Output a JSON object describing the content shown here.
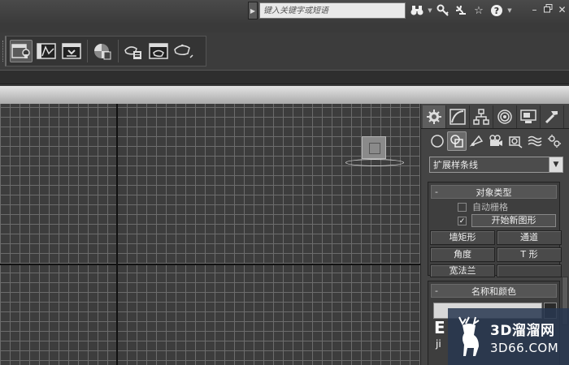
{
  "titlebar": {
    "search_placeholder": "键入关键字或短语",
    "icons": [
      "search-binoculars-icon",
      "key-icon",
      "satellite-icon",
      "star-icon",
      "help-icon"
    ],
    "window_controls": [
      "minimize-icon",
      "restore-icon",
      "close-icon"
    ]
  },
  "toolbar": {
    "icons": [
      "scene-explorer-icon",
      "curve-editor-icon",
      "schematic-view-icon",
      "material-editor-icon",
      "render-setup-icon",
      "rendered-frame-icon",
      "render-icon"
    ]
  },
  "command_panel": {
    "tabs": [
      "create-icon",
      "modify-icon",
      "hierarchy-icon",
      "motion-icon",
      "display-icon",
      "utilities-icon"
    ],
    "categories": [
      "geometry-icon",
      "shapes-icon",
      "lights-icon",
      "cameras-icon",
      "helpers-icon",
      "space-warps-icon",
      "systems-icon"
    ],
    "subcategory": "扩展样条线",
    "object_type": {
      "title": "对象类型",
      "autogrid_label": "自动栅格",
      "autogrid_checked": false,
      "start_new_shape_label": "开始新图形",
      "start_new_shape_checked": true,
      "buttons": [
        "墙矩形",
        "通道",
        "角度",
        "T 形",
        "宽法兰"
      ]
    },
    "name_color": {
      "title": "名称和颜色"
    }
  },
  "colors": {
    "viewport_bg": "#3d3d3d",
    "grid_line": "#6c6c6c",
    "axis_line": "#111111",
    "panel_bg": "#444444",
    "watermark_bg": "#28374f"
  },
  "watermark": {
    "letters": "E",
    "sub": "ji",
    "line1": "3D溜溜网",
    "line2": "3D66.COM"
  }
}
